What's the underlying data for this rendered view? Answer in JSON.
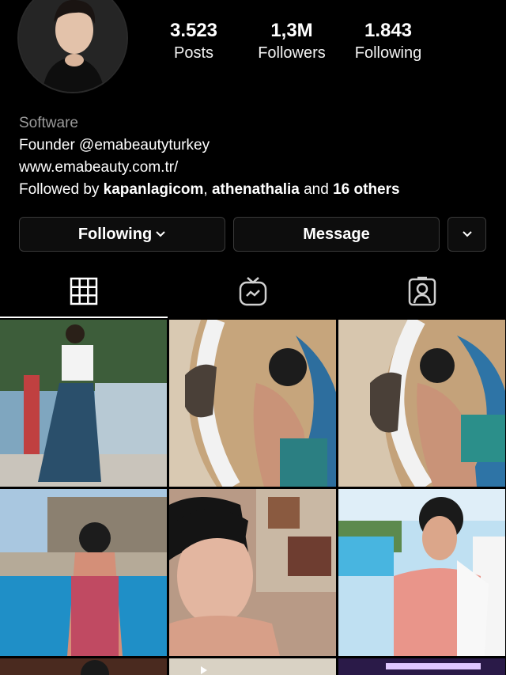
{
  "profile": {
    "stats": [
      {
        "value": "3.523",
        "label": "Posts"
      },
      {
        "value": "1,3M",
        "label": "Followers"
      },
      {
        "value": "1.843",
        "label": "Following"
      }
    ],
    "category": "Software",
    "bio_line": "Founder @emabeautyturkey",
    "website": "www.emabeauty.com.tr/",
    "followed_by": {
      "prefix": "Followed by ",
      "user1": "kapanlagicom",
      "sep": ", ",
      "user2": "athenathalia",
      "middle": " and ",
      "others": "16 others"
    }
  },
  "actions": {
    "following_label": "Following",
    "message_label": "Message"
  },
  "tabs": [
    {
      "icon": "grid-icon",
      "active": true
    },
    {
      "icon": "igtv-icon",
      "active": false
    },
    {
      "icon": "tagged-icon",
      "active": false
    }
  ],
  "colors": {
    "background": "#000000",
    "button_bg": "#0d0d0d",
    "button_border": "#3a3a3a",
    "muted_text": "#9a9a9a"
  }
}
